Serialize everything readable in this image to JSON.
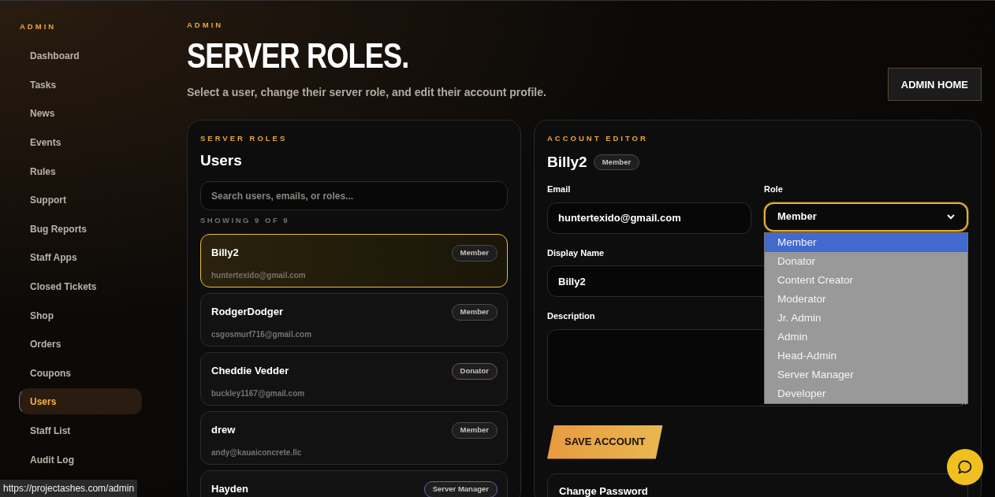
{
  "sidebar": {
    "heading": "ADMIN",
    "items": [
      {
        "label": "Dashboard",
        "selected": false
      },
      {
        "label": "Tasks",
        "selected": false
      },
      {
        "label": "News",
        "selected": false
      },
      {
        "label": "Events",
        "selected": false
      },
      {
        "label": "Rules",
        "selected": false
      },
      {
        "label": "Support",
        "selected": false
      },
      {
        "label": "Bug Reports",
        "selected": false
      },
      {
        "label": "Staff Apps",
        "selected": false
      },
      {
        "label": "Closed Tickets",
        "selected": false
      },
      {
        "label": "Shop",
        "selected": false
      },
      {
        "label": "Orders",
        "selected": false
      },
      {
        "label": "Coupons",
        "selected": false
      },
      {
        "label": "Users",
        "selected": true
      },
      {
        "label": "Staff List",
        "selected": false
      },
      {
        "label": "Audit Log",
        "selected": false
      }
    ]
  },
  "header": {
    "eyebrow": "ADMIN",
    "title": "SERVER ROLES.",
    "subtitle": "Select a user, change their server role, and edit their account profile.",
    "button": "ADMIN HOME"
  },
  "users_panel": {
    "eyebrow": "SERVER ROLES",
    "title": "Users",
    "search": {
      "placeholder": "Search users, emails, or roles..."
    },
    "count": "SHOWING 9 OF 9",
    "users": [
      {
        "name": "Billy2",
        "email": "huntertexido@gmail.com",
        "role": "Member",
        "color": "#4a4a48",
        "selected": true
      },
      {
        "name": "RodgerDodger",
        "email": "csgosmurf716@gmail.com",
        "role": "Member",
        "color": "#4a4a48",
        "selected": false
      },
      {
        "name": "Cheddie Vedder",
        "email": "buckley1167@gmail.com",
        "role": "Donator",
        "color": "#7a4a6e",
        "selected": false
      },
      {
        "name": "drew",
        "email": "andy@kauaiconcrete.llc",
        "role": "Member",
        "color": "#4a4a48",
        "selected": false
      },
      {
        "name": "Hayden",
        "role": "Server Manager",
        "color": "#6464a8",
        "selected": false
      }
    ]
  },
  "editor": {
    "eyebrow": "ACCOUNT EDITOR",
    "name": "Billy2",
    "role_badge": "Member",
    "email": {
      "label": "Email",
      "value": "huntertexido@gmail.com"
    },
    "role": {
      "label": "Role",
      "value": "Member",
      "expanded": true,
      "options": [
        {
          "label": "Member",
          "selected": true
        },
        {
          "label": "Donator",
          "selected": false
        },
        {
          "label": "Content Creator",
          "selected": false
        },
        {
          "label": "Moderator",
          "selected": false
        },
        {
          "label": "Jr. Admin",
          "selected": false
        },
        {
          "label": "Admin",
          "selected": false
        },
        {
          "label": "Head-Admin",
          "selected": false
        },
        {
          "label": "Server Manager",
          "selected": false
        },
        {
          "label": "Developer",
          "selected": false
        }
      ]
    },
    "display_name": {
      "label": "Display Name",
      "value": "Billy2"
    },
    "description": {
      "label": "Description"
    },
    "save_button": "SAVE ACCOUNT",
    "password_section": {
      "title": "Change Password"
    }
  },
  "status_bar": {
    "url": "https://projectashes.com/admin"
  }
}
